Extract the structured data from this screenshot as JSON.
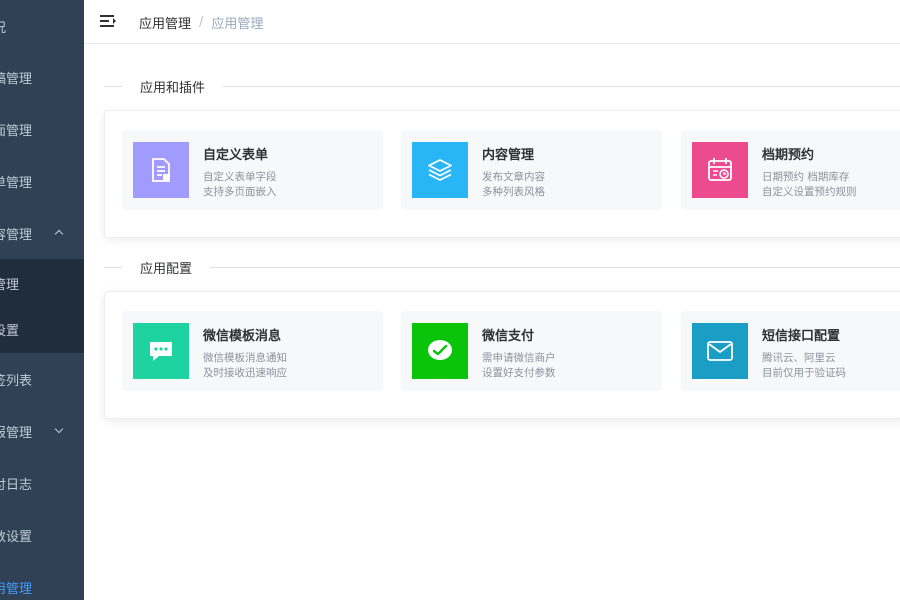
{
  "sidebar": {
    "items": [
      {
        "label": "况"
      },
      {
        "label": "稿管理"
      },
      {
        "label": "面管理"
      },
      {
        "label": "单管理"
      },
      {
        "label": "容管理"
      },
      {
        "label": "管理"
      },
      {
        "label": "设置"
      },
      {
        "label": "签列表"
      },
      {
        "label": "报管理"
      },
      {
        "label": "付日志"
      },
      {
        "label": "数设置"
      },
      {
        "label": "用管理"
      }
    ]
  },
  "header": {
    "breadcrumb": [
      "应用管理",
      "/",
      "应用管理"
    ]
  },
  "sections": [
    {
      "title": "应用和插件",
      "cards": [
        {
          "title": "自定义表单",
          "desc1": "自定义表单字段",
          "desc2": "支持多页面嵌入",
          "color": "#a29bfe",
          "icon": "form-icon"
        },
        {
          "title": "内容管理",
          "desc1": "发布文章内容",
          "desc2": "多种列表风格",
          "color": "#29b6f6",
          "icon": "layers-icon"
        },
        {
          "title": "档期预约",
          "desc1": "日期预约 档期库存",
          "desc2": "自定义设置预约规则",
          "color": "#ec4c8f",
          "icon": "calendar-icon"
        }
      ]
    },
    {
      "title": "应用配置",
      "cards": [
        {
          "title": "微信模板消息",
          "desc1": "微信模板消息通知",
          "desc2": "及时接收迅速响应",
          "color": "#1fd3a0",
          "icon": "message-icon"
        },
        {
          "title": "微信支付",
          "desc1": "需申请微信商户",
          "desc2": "设置好支付参数",
          "color": "#09c409",
          "icon": "wechat-pay-icon"
        },
        {
          "title": "短信接口配置",
          "desc1": "腾讯云、阿里云",
          "desc2": "目前仅用于验证码",
          "color": "#1a9ec6",
          "icon": "mail-icon"
        }
      ]
    }
  ]
}
